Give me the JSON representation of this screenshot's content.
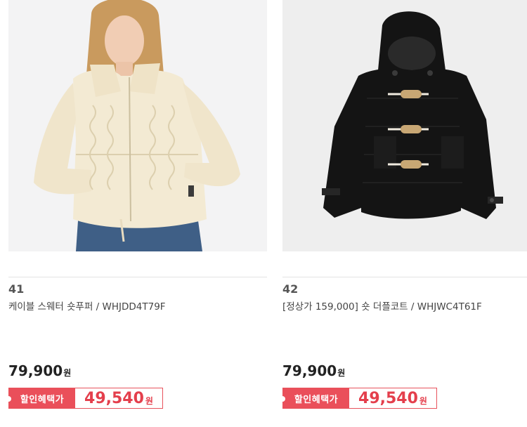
{
  "products": [
    {
      "rank": "41",
      "title": "케이블 스웨터 숏푸퍼 / WHJDD4T79F",
      "price": "79,900",
      "price_unit": "원",
      "benefit_label": "할인혜택가",
      "benefit_price": "49,540",
      "benefit_unit": "원",
      "image": "cream-cable-knit-puffer-jacket"
    },
    {
      "rank": "42",
      "title": "[정상가 159,000] 숏 더플코트 / WHJWC4T61F",
      "price": "79,900",
      "price_unit": "원",
      "benefit_label": "할인혜택가",
      "benefit_price": "49,540",
      "benefit_unit": "원",
      "image": "black-duffle-coat"
    }
  ],
  "colors": {
    "accent": "#ea4f5a",
    "sale_text": "#e43f4c",
    "coat": "#141414",
    "puffer": "#f3ead3"
  }
}
